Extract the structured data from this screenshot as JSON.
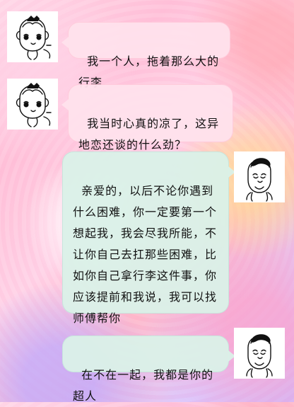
{
  "messages": [
    {
      "id": "m1",
      "side": "left",
      "text": "我一个人，拖着那么大的行李"
    },
    {
      "id": "m2",
      "side": "left",
      "text": "我当时心真的凉了，这异地恋还谈的什么劲？"
    },
    {
      "id": "m3",
      "side": "right",
      "text": "亲爱的，以后不论你遇到什么困难，你一定要第一个想起我，我会尽我所能，不让你自己去扛那些困难，比如你自己拿行李这件事，你应该提前和我说，我可以找师傅帮你"
    },
    {
      "id": "m4",
      "side": "right",
      "text": "在不在一起，我都是你的超人"
    }
  ],
  "colors": {
    "left_bubble": "#ffe1ec",
    "right_bubble": "#daf1e8"
  },
  "avatars": {
    "left_icon": "cartoon-girl-icon",
    "right_icon": "cartoon-boy-icon"
  }
}
